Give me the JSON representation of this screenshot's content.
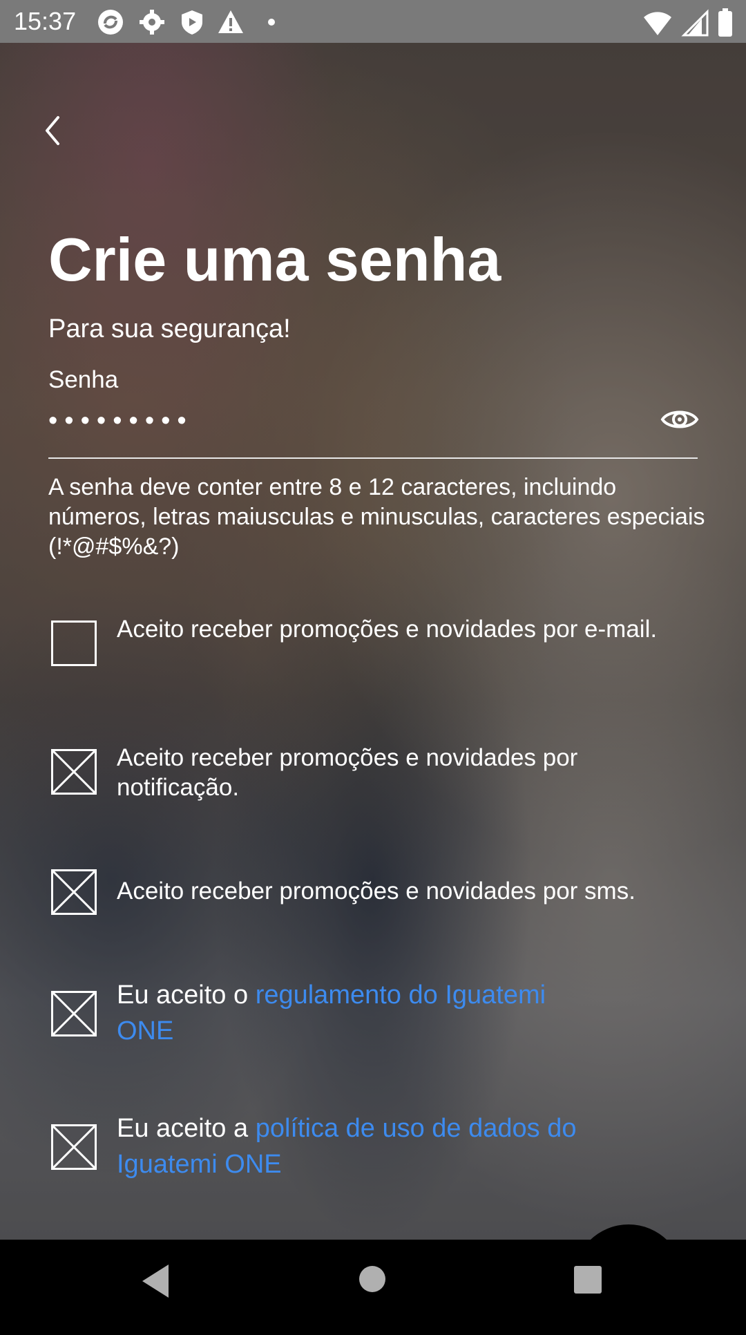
{
  "status_bar": {
    "time": "15:37",
    "left_icons": [
      "sync-icon",
      "gear-icon",
      "shield-icon",
      "warning-icon",
      "dot-icon"
    ],
    "right_icons": [
      "wifi-icon",
      "signal-icon",
      "battery-icon"
    ]
  },
  "header": {
    "title": "Crie uma senha",
    "subtitle": "Para sua segurança!"
  },
  "password": {
    "label": "Senha",
    "value": "•••••••••"
  },
  "hint": "A senha deve conter entre 8 e 12 caracteres, incluindo números, letras maiusculas e minusculas, caracteres especiais (!*@#$%&?)",
  "checkboxes": [
    {
      "label": "Aceito receber promoções e novidades por e-mail.",
      "checked": false
    },
    {
      "label": "Aceito receber promoções e novidades por notificação.",
      "checked": true
    },
    {
      "label": "Aceito receber promoções e novidades por sms.",
      "checked": true
    },
    {
      "prefix": "Eu aceito o ",
      "link": "regulamento do Iguatemi ONE",
      "checked": true
    },
    {
      "prefix": "Eu aceito a ",
      "link": "política de uso de dados do Iguatemi ONE",
      "checked": true
    }
  ],
  "colors": {
    "link": "#3d8bef",
    "status_bar": "#7a7a7a",
    "nav_bar": "#000000"
  }
}
